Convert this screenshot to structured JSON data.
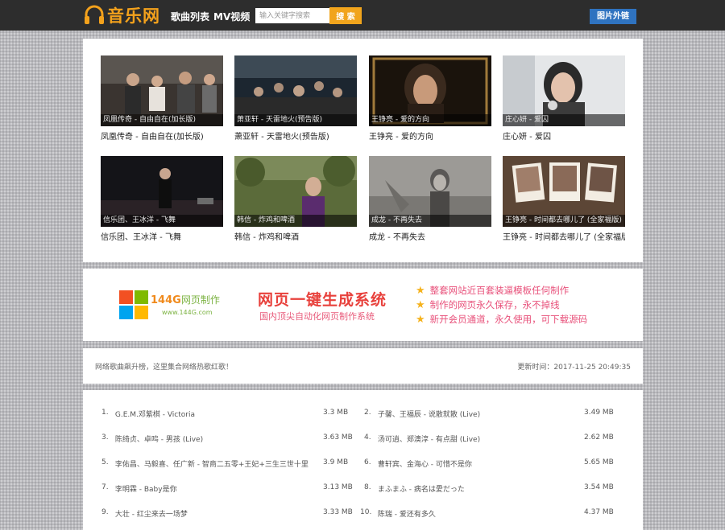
{
  "header": {
    "logo_text": "音乐网",
    "nav": [
      "歌曲列表",
      "MV视频"
    ],
    "search_placeholder": "输入关键字搜索",
    "search_button": "搜 索",
    "external_button": "图片外链"
  },
  "mvs": [
    {
      "overlay": "凤凰传奇 - 自由自在(加长版)",
      "caption": "凤凰传奇 - 自由自在(加长版)"
    },
    {
      "overlay": "萧亚轩 - 天雷地火(预告版)",
      "caption": "萧亚轩 - 天雷地火(预告版)"
    },
    {
      "overlay": "王铮亮 - 爱的方向",
      "caption": "王铮亮 - 爱的方向"
    },
    {
      "overlay": "庄心妍 - 爱囚",
      "caption": "庄心妍 - 爱囚"
    },
    {
      "overlay": "信乐团、王冰洋 - 飞舞",
      "caption": "信乐团、王冰洋 - 飞舞"
    },
    {
      "overlay": "韩信 - 炸鸡和啤酒",
      "caption": "韩信 - 炸鸡和啤酒"
    },
    {
      "overlay": "成龙 - 不再失去",
      "caption": "成龙 - 不再失去"
    },
    {
      "overlay": "王铮亮 - 时间都去哪儿了 (全家福版)",
      "caption": "王铮亮 - 时间都去哪儿了 (全家福版)"
    }
  ],
  "ad": {
    "brand_num": "144G",
    "brand_cn": "网页制作",
    "brand_url": "www.144G.com",
    "title": "网页一键生成系统",
    "subtitle": "国内顶尖自动化网页制作系统",
    "features": [
      "整套网站近百套装逼模板任何制作",
      "制作的网页永久保存，永不掉线",
      "新开会员通道，永久使用，可下载源码"
    ]
  },
  "info": {
    "left": "网络歌曲飙升榜，这里集合网络热歌红歌！",
    "right": "更新时间：2017-11-25 20:49:35"
  },
  "songs": [
    {
      "idx": "1.",
      "name": "G.E.M.邓紫棋 - Victoria",
      "size": "3.3 MB"
    },
    {
      "idx": "2.",
      "name": "子馨、王福辰 - 说散就散 (Live)",
      "size": "3.49 MB"
    },
    {
      "idx": "3.",
      "name": "陈绮贞、卓鸣 - 男孩 (Live)",
      "size": "3.63 MB"
    },
    {
      "idx": "4.",
      "name": "汤可逍、郑澳淳 - 有点甜 (Live)",
      "size": "2.62 MB"
    },
    {
      "idx": "5.",
      "name": "李佑昌、马毅喜、任广新 - 智商二五零+王妃+三生三世十里...",
      "size": "3.9 MB"
    },
    {
      "idx": "6.",
      "name": "曹轩宾、金海心 - 可惜不是你",
      "size": "5.65 MB"
    },
    {
      "idx": "7.",
      "name": "李明霖 - Baby是你",
      "size": "3.13 MB"
    },
    {
      "idx": "8.",
      "name": "まふまふ - 病名は愛だった",
      "size": "3.54 MB"
    },
    {
      "idx": "9.",
      "name": "大壮 - 红尘来去一场梦",
      "size": "3.33 MB"
    },
    {
      "idx": "10.",
      "name": "陈瑞 - 爱还有多久",
      "size": "4.37 MB"
    }
  ],
  "colors": {
    "header_bg": "#2d2d2d",
    "logo": "#f4a21c",
    "search_button": "#f1a41c",
    "external_button": "#2f73c0",
    "ad_title": "#e8413c",
    "ad_text": "#e8507a"
  },
  "icons": {
    "logo": "headphones-icon",
    "ad_logo": "windows-logo-icon",
    "feature_bullet": "star-icon"
  }
}
